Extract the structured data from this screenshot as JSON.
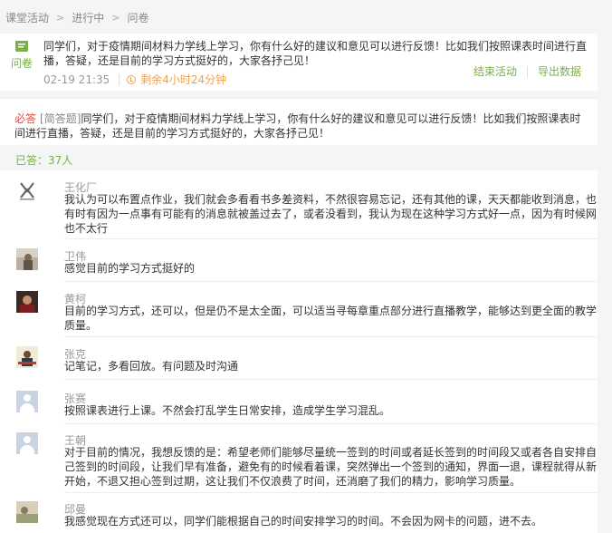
{
  "breadcrumb": [
    "课堂活动",
    "进行中",
    "问卷"
  ],
  "header": {
    "type_label": "问卷",
    "title": "同学们，对于疫情期间材料力学线上学习，你有什么好的建议和意见可以进行反馈！比如我们按照课表时间进行直播，答疑，还是目前的学习方式挺好的，大家各抒己见！",
    "date": "02-19 21:35",
    "remaining": "剩余4小时24分钟",
    "end_label": "结束活动",
    "export_label": "导出数据"
  },
  "question": {
    "required": "必答",
    "type": "[简答题]",
    "text": "同学们，对于疫情期间材料力学线上学习，你有什么好的建议和意见可以进行反馈！比如我们按照课表时间进行直播，答疑，还是目前的学习方式挺好的，大家各抒己见！"
  },
  "answered_count": "已答：37人",
  "answers": [
    {
      "name": "王化厂",
      "content": "我认为可以布置点作业，我们就会多看看书多差资料，不然很容易忘记，还有其他的课，天天都能收到消息，也有时有因为一点事有可能有的消息就被盖过去了，或者没看到，我认为现在这种学习方式好一点，因为有时候网也不太行"
    },
    {
      "name": "卫伟",
      "content": "感觉目前的学习方式挺好的"
    },
    {
      "name": "黄柯",
      "content": "目前的学习方式，还可以，但是仍不是太全面，可以适当寻每章重点部分进行直播教学，能够达到更全面的教学质量。"
    },
    {
      "name": "张克",
      "content": "记笔记，多看回放。有问题及时沟通"
    },
    {
      "name": "张赛",
      "content": "按照课表进行上课。不然会打乱学生日常安排，造成学生学习混乱。"
    },
    {
      "name": "王朝",
      "content": "对于目前的情况，我想反馈的是：希望老师们能够尽量统一签到的时间或者延长签到的时间段又或者各自安排自己签到的时间段，让我们早有准备，避免有的时候看着课，突然弹出一个签到的通知，界面一退，课程就得从新开始，不退又担心签到过期，这让我们不仅浪费了时间，还消磨了我们的精力，影响学习质量。"
    },
    {
      "name": "邱曼",
      "content": "我感觉现在方式还可以，同学们能根据自己的时间安排学习的时间。不会因为网卡的问题，进不去。"
    }
  ],
  "colors": {
    "accent": "#78b04a",
    "warning": "#f0a050",
    "required": "#e74c3c"
  }
}
